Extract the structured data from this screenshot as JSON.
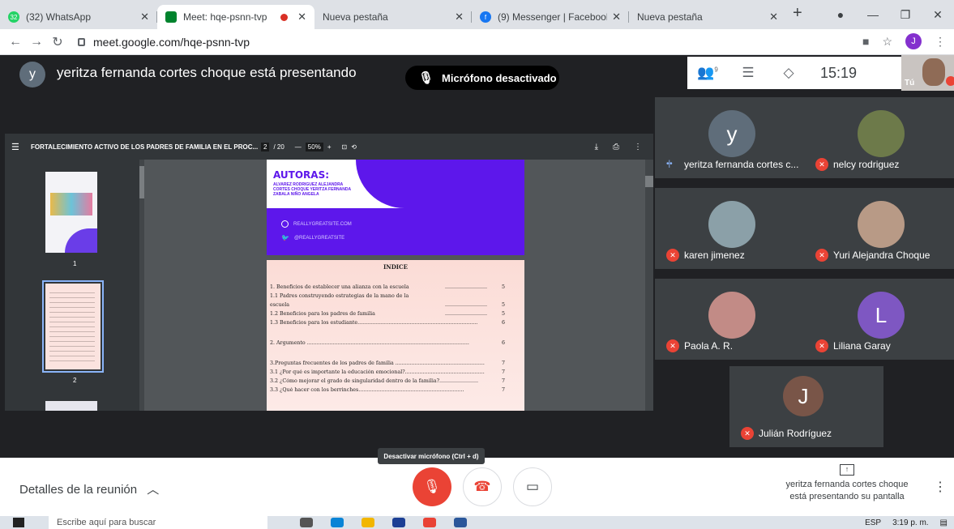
{
  "browser": {
    "tabs": [
      {
        "title": "(32) WhatsApp",
        "badge": "32"
      },
      {
        "title": "Meet: hqe-psnn-tvp"
      },
      {
        "title": "Nueva pestaña"
      },
      {
        "title": "(9) Messenger | Facebook"
      },
      {
        "title": "Nueva pestaña"
      }
    ],
    "url": "meet.google.com/hqe-psnn-tvp",
    "profile_initial": "J"
  },
  "meet": {
    "presenter_initial": "y",
    "presenting_text": "yeritza fernanda cortes choque está presentando",
    "mic_off_notice": "Micrófono desactivado",
    "participants_count": "9",
    "clock": "15:19",
    "self_label": "Tú"
  },
  "pdf": {
    "document_title": "FORTALECIMIENTO ACTIVO DE LOS PADRES DE FAMILIA EN EL PROC...",
    "page": "2",
    "page_total": "/ 20",
    "zoom": "50%",
    "thumb_labels": [
      "1",
      "2"
    ],
    "autoras_title": "AUTORAS:",
    "autoras": [
      "ALVAREZ RODRIGUEZ ALEJANDRA",
      "CORTES CHOQUE YERITZA FERNANDA",
      "ZABALA NIÑO ANGELA"
    ],
    "website": "REALLYGREATSITE.COM",
    "twitter": "@REALLYGREATSITE",
    "index_title": "INDICE",
    "index": [
      {
        "text": "1.  Beneficios de establecer una alianza con la escuela",
        "dots": "..........................",
        "page": "5"
      },
      {
        "text": "1.1  Padres construyendo estrategias de la mano de la",
        "dots": "",
        "page": ""
      },
      {
        "text": "escuela",
        "dots": "..........................",
        "page": "5"
      },
      {
        "text": "1.2  Beneficios para los padres de familia",
        "dots": "..........................",
        "page": "5"
      },
      {
        "text": "1.3  Beneficios para los estudiante..........................................................................",
        "dots": "",
        "page": "6"
      },
      {
        "text": "2.   Argumento ....................................................................................................",
        "dots": "",
        "page": "6"
      },
      {
        "text": "3.Preguntas frecuentes de los padres de familia .......................................................",
        "dots": "",
        "page": "7"
      },
      {
        "text": "3.1  ¿Por qué es importante la educación emocional?.................................................",
        "dots": "",
        "page": "7"
      },
      {
        "text": "3.2  ¿Cómo mejorar el grado de singularidad dentro de la familia?........................",
        "dots": "",
        "page": "7"
      },
      {
        "text": "3.3  ¿Qué hacer con los berrinches.................................................................",
        "dots": "",
        "page": "7"
      }
    ]
  },
  "participants": [
    {
      "name": "yeritza fernanda cortes c...",
      "initial": "y",
      "color": "#5f6d7a",
      "speaking": true
    },
    {
      "name": "nelcy rodriguez",
      "initial": "",
      "color": "#6d7a4a",
      "muted": true
    },
    {
      "name": "karen jimenez",
      "initial": "",
      "color": "#8ba0a8",
      "muted": true
    },
    {
      "name": "Yuri Alejandra Choque",
      "initial": "",
      "color": "#b89a86",
      "muted": true
    },
    {
      "name": "Paola A. R.",
      "initial": "",
      "color": "#c28b86",
      "muted": true
    },
    {
      "name": "Liliana Garay",
      "initial": "L",
      "color": "#7e57c2",
      "muted": true
    },
    {
      "name": "Julián Rodríguez",
      "initial": "J",
      "color": "#795548",
      "muted": true
    }
  ],
  "controls": {
    "meeting_details": "Detalles de la reunión",
    "tooltip": "Desactivar micrófono (Ctrl + d)",
    "sharing_status": "yeritza fernanda cortes choque está presentando su pantalla"
  },
  "taskbar": {
    "search_placeholder": "Escribe aquí para buscar",
    "time": "3:19 p. m.",
    "lang": "ESP"
  },
  "colors": {
    "accent_red": "#ea4335",
    "pdf_purple": "#5d17eb",
    "meet_bg": "#202124"
  }
}
